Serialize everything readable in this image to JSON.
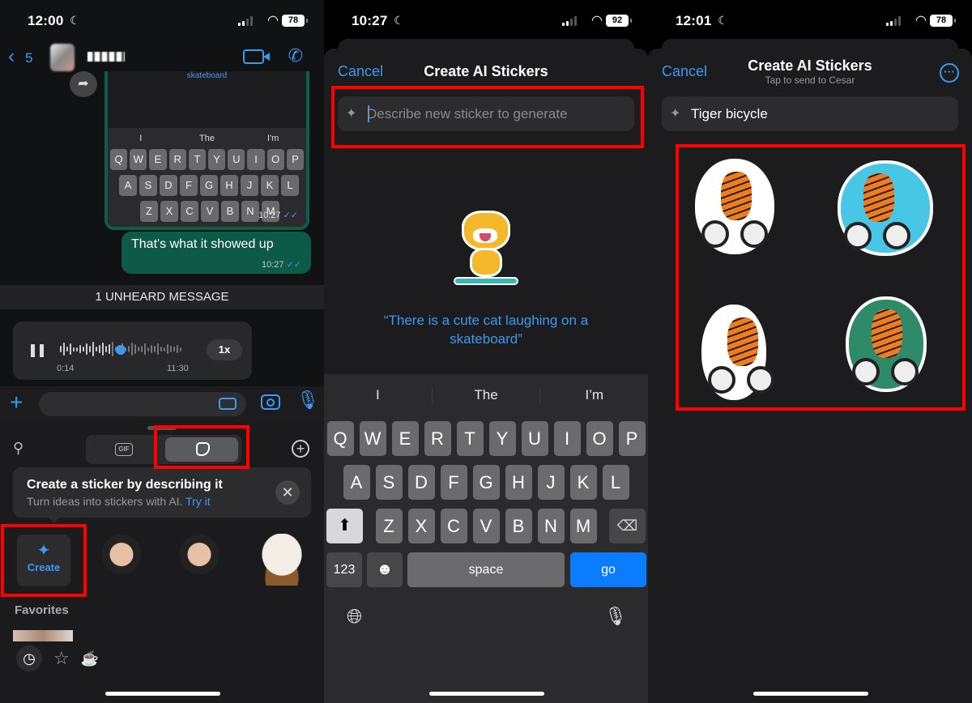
{
  "panels": [
    {
      "status": {
        "time": "12:00",
        "battery": "78"
      },
      "chat": {
        "back_count": "5",
        "image_caption": "skateboard",
        "mini_keyboard": {
          "suggestions": [
            "I",
            "The",
            "I'm"
          ],
          "row1": [
            "Q",
            "W",
            "E",
            "R",
            "T",
            "Y",
            "U",
            "I",
            "O",
            "P"
          ],
          "row2": [
            "A",
            "S",
            "D",
            "F",
            "G",
            "H",
            "J",
            "K",
            "L"
          ],
          "row3": [
            "Z",
            "X",
            "C",
            "V",
            "B",
            "N",
            "M"
          ]
        },
        "image_time": "10:27",
        "outgoing_text": "That's what it showed up",
        "outgoing_time": "10:27",
        "unheard_banner": "1 UNHEARD MESSAGE",
        "voice": {
          "elapsed": "0:14",
          "timestamp": "11:30",
          "speed": "1x",
          "progress": 0.42
        }
      },
      "drawer": {
        "gif_label": "GIF",
        "tip_title": "Create a sticker by describing it",
        "tip_subtitle": "Turn ideas into stickers with AI.",
        "tip_link": "Try it",
        "create_label": "Create",
        "favorites_label": "Favorites"
      }
    },
    {
      "status": {
        "time": "10:27",
        "battery": "92"
      },
      "sheet": {
        "cancel": "Cancel",
        "title": "Create AI Stickers",
        "prompt_placeholder": "Describe new sticker to generate",
        "example_quote": "“There is a cute cat laughing on a skateboard”"
      },
      "keyboard": {
        "suggestions": [
          "I",
          "The",
          "I’m"
        ],
        "row1": [
          "Q",
          "W",
          "E",
          "R",
          "T",
          "Y",
          "U",
          "I",
          "O",
          "P"
        ],
        "row2": [
          "A",
          "S",
          "D",
          "F",
          "G",
          "H",
          "J",
          "K",
          "L"
        ],
        "row3": [
          "Z",
          "X",
          "C",
          "V",
          "B",
          "N",
          "M"
        ],
        "num_label": "123",
        "space_label": "space",
        "go_label": "go"
      }
    },
    {
      "status": {
        "time": "12:01",
        "battery": "78"
      },
      "sheet": {
        "cancel": "Cancel",
        "title": "Create AI Stickers",
        "subtitle": "Tap to send to Cesar",
        "prompt_value": "Tiger bicycle"
      },
      "stickers": [
        {
          "name": "tiger-top-hat-sunglasses-bicycle",
          "bg": "#ffffff"
        },
        {
          "name": "tiger-forest-circle-bicycle",
          "bg": "#47c6e6"
        },
        {
          "name": "tiger-small-bicycle",
          "bg": "#ffffff"
        },
        {
          "name": "tiger-pine-forest-bicycle",
          "bg": "#2f8a6a"
        }
      ]
    }
  ],
  "colors": {
    "accent": "#3a9bf2",
    "highlight": "#ff0000",
    "outgoing_bubble": "#0d5a46",
    "go_key": "#0a7cff"
  }
}
